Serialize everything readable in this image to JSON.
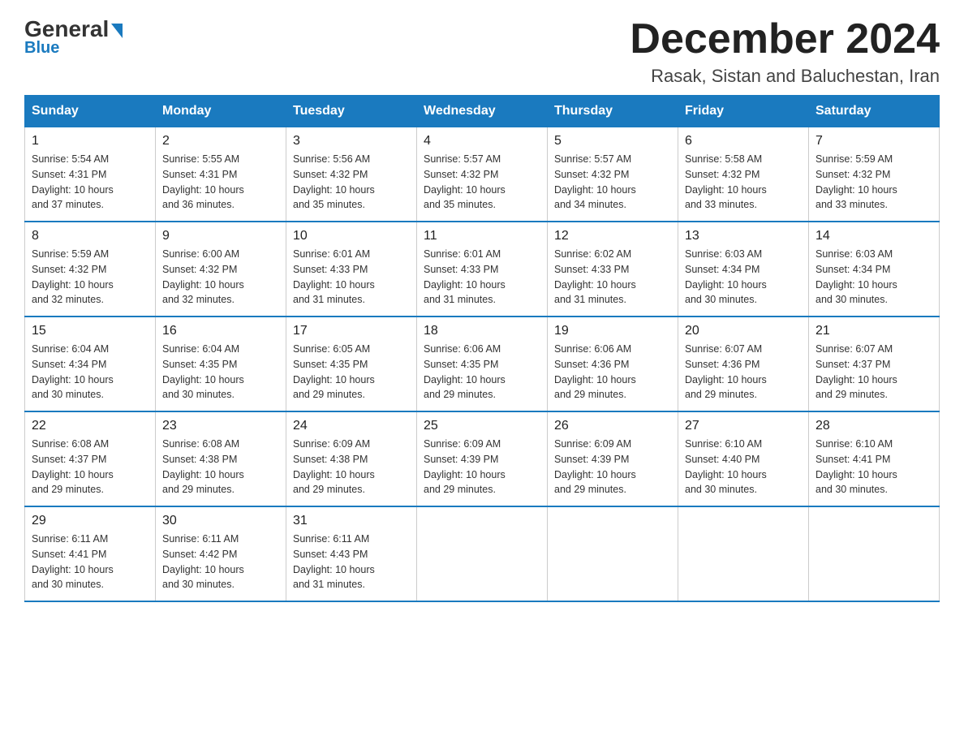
{
  "header": {
    "logo_text1": "General",
    "logo_text2": "Blue",
    "month_year": "December 2024",
    "location": "Rasak, Sistan and Baluchestan, Iran"
  },
  "weekdays": [
    "Sunday",
    "Monday",
    "Tuesday",
    "Wednesday",
    "Thursday",
    "Friday",
    "Saturday"
  ],
  "weeks": [
    [
      {
        "day": "1",
        "sunrise": "5:54 AM",
        "sunset": "4:31 PM",
        "daylight": "10 hours and 37 minutes."
      },
      {
        "day": "2",
        "sunrise": "5:55 AM",
        "sunset": "4:31 PM",
        "daylight": "10 hours and 36 minutes."
      },
      {
        "day": "3",
        "sunrise": "5:56 AM",
        "sunset": "4:32 PM",
        "daylight": "10 hours and 35 minutes."
      },
      {
        "day": "4",
        "sunrise": "5:57 AM",
        "sunset": "4:32 PM",
        "daylight": "10 hours and 35 minutes."
      },
      {
        "day": "5",
        "sunrise": "5:57 AM",
        "sunset": "4:32 PM",
        "daylight": "10 hours and 34 minutes."
      },
      {
        "day": "6",
        "sunrise": "5:58 AM",
        "sunset": "4:32 PM",
        "daylight": "10 hours and 33 minutes."
      },
      {
        "day": "7",
        "sunrise": "5:59 AM",
        "sunset": "4:32 PM",
        "daylight": "10 hours and 33 minutes."
      }
    ],
    [
      {
        "day": "8",
        "sunrise": "5:59 AM",
        "sunset": "4:32 PM",
        "daylight": "10 hours and 32 minutes."
      },
      {
        "day": "9",
        "sunrise": "6:00 AM",
        "sunset": "4:32 PM",
        "daylight": "10 hours and 32 minutes."
      },
      {
        "day": "10",
        "sunrise": "6:01 AM",
        "sunset": "4:33 PM",
        "daylight": "10 hours and 31 minutes."
      },
      {
        "day": "11",
        "sunrise": "6:01 AM",
        "sunset": "4:33 PM",
        "daylight": "10 hours and 31 minutes."
      },
      {
        "day": "12",
        "sunrise": "6:02 AM",
        "sunset": "4:33 PM",
        "daylight": "10 hours and 31 minutes."
      },
      {
        "day": "13",
        "sunrise": "6:03 AM",
        "sunset": "4:34 PM",
        "daylight": "10 hours and 30 minutes."
      },
      {
        "day": "14",
        "sunrise": "6:03 AM",
        "sunset": "4:34 PM",
        "daylight": "10 hours and 30 minutes."
      }
    ],
    [
      {
        "day": "15",
        "sunrise": "6:04 AM",
        "sunset": "4:34 PM",
        "daylight": "10 hours and 30 minutes."
      },
      {
        "day": "16",
        "sunrise": "6:04 AM",
        "sunset": "4:35 PM",
        "daylight": "10 hours and 30 minutes."
      },
      {
        "day": "17",
        "sunrise": "6:05 AM",
        "sunset": "4:35 PM",
        "daylight": "10 hours and 29 minutes."
      },
      {
        "day": "18",
        "sunrise": "6:06 AM",
        "sunset": "4:35 PM",
        "daylight": "10 hours and 29 minutes."
      },
      {
        "day": "19",
        "sunrise": "6:06 AM",
        "sunset": "4:36 PM",
        "daylight": "10 hours and 29 minutes."
      },
      {
        "day": "20",
        "sunrise": "6:07 AM",
        "sunset": "4:36 PM",
        "daylight": "10 hours and 29 minutes."
      },
      {
        "day": "21",
        "sunrise": "6:07 AM",
        "sunset": "4:37 PM",
        "daylight": "10 hours and 29 minutes."
      }
    ],
    [
      {
        "day": "22",
        "sunrise": "6:08 AM",
        "sunset": "4:37 PM",
        "daylight": "10 hours and 29 minutes."
      },
      {
        "day": "23",
        "sunrise": "6:08 AM",
        "sunset": "4:38 PM",
        "daylight": "10 hours and 29 minutes."
      },
      {
        "day": "24",
        "sunrise": "6:09 AM",
        "sunset": "4:38 PM",
        "daylight": "10 hours and 29 minutes."
      },
      {
        "day": "25",
        "sunrise": "6:09 AM",
        "sunset": "4:39 PM",
        "daylight": "10 hours and 29 minutes."
      },
      {
        "day": "26",
        "sunrise": "6:09 AM",
        "sunset": "4:39 PM",
        "daylight": "10 hours and 29 minutes."
      },
      {
        "day": "27",
        "sunrise": "6:10 AM",
        "sunset": "4:40 PM",
        "daylight": "10 hours and 30 minutes."
      },
      {
        "day": "28",
        "sunrise": "6:10 AM",
        "sunset": "4:41 PM",
        "daylight": "10 hours and 30 minutes."
      }
    ],
    [
      {
        "day": "29",
        "sunrise": "6:11 AM",
        "sunset": "4:41 PM",
        "daylight": "10 hours and 30 minutes."
      },
      {
        "day": "30",
        "sunrise": "6:11 AM",
        "sunset": "4:42 PM",
        "daylight": "10 hours and 30 minutes."
      },
      {
        "day": "31",
        "sunrise": "6:11 AM",
        "sunset": "4:43 PM",
        "daylight": "10 hours and 31 minutes."
      },
      null,
      null,
      null,
      null
    ]
  ]
}
